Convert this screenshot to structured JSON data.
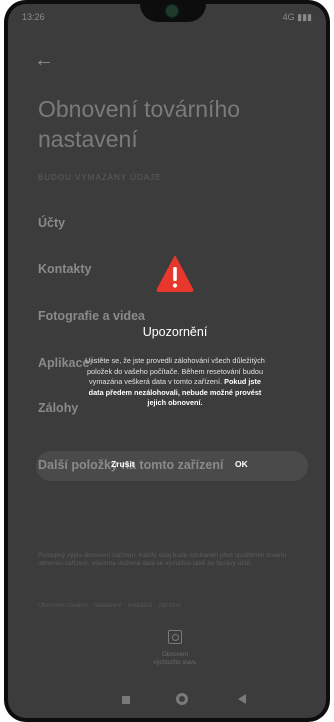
{
  "status_bar": {
    "time": "13:26",
    "right": "4G ▮▮▮"
  },
  "page": {
    "title": "Obnovení továrního nastavení",
    "subtitle": "BUDOU VYMAZÁNY ÚDAJE",
    "rows": [
      "Účty",
      "Kontakty",
      "Fotografie a videa",
      "Aplikace",
      "Zálohy"
    ],
    "next_label": "Další položky na tomto zařízení",
    "footnote": "Postupný výpis obnovení zařízení. Každý údaj bude odstraněn před spuštěním tovární obnovou zařízení, všechna uložená data se vymažou také ze Správy účtů.",
    "footnote2": "Obnovení tovární · nastavení · ovládání · zařízení",
    "restore_label": "Obnovení výchozího stavu"
  },
  "dialog": {
    "title": "Upozornění",
    "body_normal": "Ujistěte se, že jste provedli zálohování všech důležitých položek do vašeho počítače. Během resetování budou vymazána veškerá data v tomto zařízení. ",
    "body_bold": "Pokud jste data předem nezálohovali, nebude možné provést jejich obnovení.",
    "cancel_label": "Zrušit",
    "ok_label": "OK"
  },
  "colors": {
    "warning": "#e8372c",
    "background": "#3c3c3c"
  },
  "icons": [
    "back-arrow-icon",
    "warning-icon",
    "restore-icon",
    "nav-recents-icon",
    "nav-home-icon",
    "nav-back-icon"
  ]
}
